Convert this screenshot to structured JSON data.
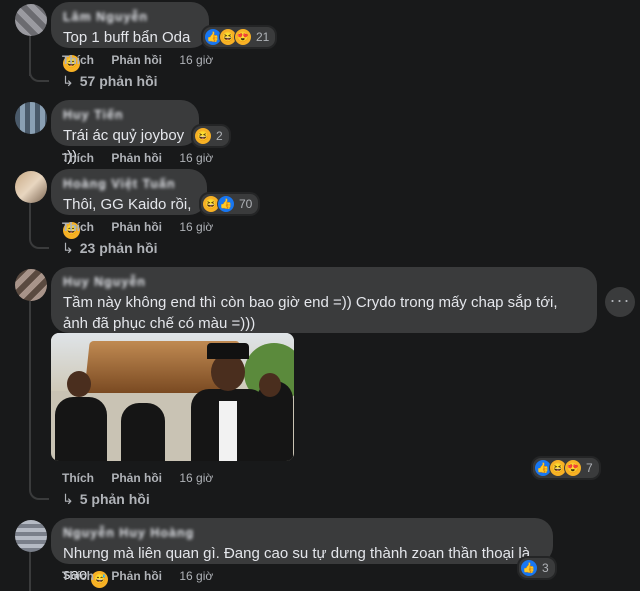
{
  "comments": [
    {
      "author": "Lâm Nguyễn",
      "text": "Top 1 buff bẩn Oda",
      "reactions": [
        "like",
        "haha",
        "love"
      ],
      "reaction_count": "21",
      "like_label": "Thích",
      "reply_label": "Phản hồi",
      "time": "16 giờ",
      "replies": "57 phản hồi"
    },
    {
      "author": "Huy Tiến",
      "text": "Trái ác quỷ joyboy :))",
      "reactions": [
        "haha"
      ],
      "reaction_count": "2",
      "like_label": "Thích",
      "reply_label": "Phản hồi",
      "time": "16 giờ"
    },
    {
      "author": "Hoàng Việt Tuấn",
      "text": "Thôi, GG Kaido rồi,",
      "reactions": [
        "haha",
        "like"
      ],
      "reaction_count": "70",
      "like_label": "Thích",
      "reply_label": "Phản hồi",
      "time": "16 giờ",
      "replies": "23 phản hồi"
    },
    {
      "author": "Huy Nguyễn",
      "text": "Tầm này không end thì còn bao giờ end =)) Crydo trong mấy chap sắp tới, ảnh đã phục chế có màu =)))",
      "reactions": [
        "like",
        "haha",
        "love"
      ],
      "reaction_count": "7",
      "like_label": "Thích",
      "reply_label": "Phản hồi",
      "time": "16 giờ",
      "replies": "5 phản hồi",
      "more_button": "···"
    },
    {
      "author": "Nguyễn Huy Hoàng",
      "text": "Nhưng mà liên quan gì. Đang cao su tự dưng thành zoan thần thoại là sao",
      "reactions": [
        "like"
      ],
      "reaction_count": "3",
      "like_label": "Thích",
      "reply_label": "Phản hồi",
      "time": "16 giờ"
    }
  ],
  "colors": {
    "background": "#18191a",
    "bubble": "#3a3b3c",
    "text": "#e4e6eb",
    "muted": "#b0b3b8",
    "like": "#1877f2",
    "haha": "#f7b125",
    "love": "#f33e58"
  }
}
